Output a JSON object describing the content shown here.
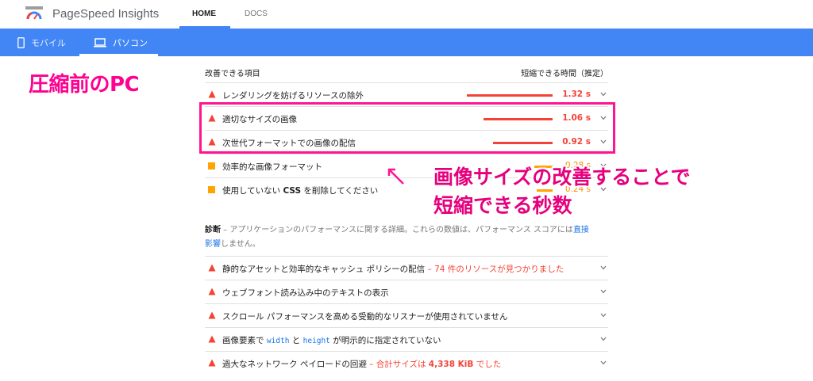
{
  "header": {
    "app_title": "PageSpeed Insights",
    "tabs": [
      {
        "label": "HOME",
        "active": true
      },
      {
        "label": "DOCS",
        "active": false
      }
    ]
  },
  "device_bar": {
    "tabs": [
      {
        "label": "モバイル",
        "icon": "phone-icon",
        "active": false
      },
      {
        "label": "パソコン",
        "icon": "laptop-icon",
        "active": true
      }
    ]
  },
  "annotations": {
    "left_label": "圧縮前のPC",
    "right_label_line1": "画像サイズの改善することで",
    "right_label_line2": "短縮できる秒数",
    "arrow": "↖"
  },
  "opportunities": {
    "header_left": "改善できる項目",
    "header_right": "短縮できる時間（推定）",
    "items": [
      {
        "label": "レンダリングを妨げるリソースの除外",
        "value": "1.32 s",
        "savings_s": 1.32,
        "severity": "red"
      },
      {
        "label": "適切なサイズの画像",
        "value": "1.06 s",
        "savings_s": 1.06,
        "severity": "red"
      },
      {
        "label": "次世代フォーマットでの画像の配信",
        "value": "0.92 s",
        "savings_s": 0.92,
        "severity": "red"
      },
      {
        "label": "効率的な画像フォーマット",
        "value": "0.28 s",
        "savings_s": 0.28,
        "severity": "orange"
      },
      {
        "label_parts": [
          "使用していない ",
          "CSS",
          " を削除してください"
        ],
        "value": "0.24 s",
        "savings_s": 0.24,
        "severity": "orange"
      }
    ]
  },
  "diagnostics": {
    "title": "診断",
    "description": " – アプリケーションのパフォーマンスに関する詳細。これらの数値は、パフォーマンス スコアには",
    "link_text_1": "直接",
    "link_text_2": "影響",
    "description_tail": "しません。",
    "items": [
      {
        "label": "静的なアセットと効率的なキャッシュ ポリシーの配信",
        "detail": " – 74 件のリソースが見つかりました"
      },
      {
        "label": "ウェブフォント読み込み中のテキストの表示",
        "detail": ""
      },
      {
        "label": "スクロール パフォーマンスを高める受動的なリスナーが使用されていません",
        "detail": ""
      },
      {
        "label_parts": [
          "画像要素で ",
          "width",
          " と ",
          "height",
          " が明示的に指定されていない"
        ],
        "detail": ""
      },
      {
        "label": "過大なネットワーク ペイロードの回避",
        "detail_parts": [
          " – 合計サイズは ",
          "4,338 KiB",
          " でした"
        ]
      }
    ]
  },
  "colors": {
    "brand_blue": "#4285f4",
    "fail_red": "#f44336",
    "average_orange": "#ffa400",
    "annotation_pink": "#ff1493"
  }
}
